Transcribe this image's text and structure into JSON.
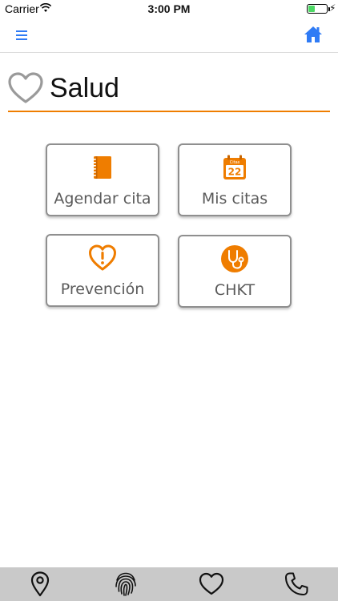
{
  "status_bar": {
    "carrier": "Carrier",
    "time": "3:00 PM",
    "battery_level": 0.35,
    "battery_color": "#4cd964",
    "icons": [
      "wifi-icon",
      "battery-icon",
      "charging-icon"
    ]
  },
  "nav_bar": {
    "left_icon": "menu-icon",
    "right_icon": "home-icon",
    "accent_color": "#2f7bf5"
  },
  "header": {
    "title": "Salud",
    "icon": "heart-outline-icon",
    "underline_color": "#ef7d00"
  },
  "tiles": [
    {
      "label": "Agendar cita",
      "icon": "notebook-icon"
    },
    {
      "label": "Mis citas",
      "icon": "calendar-icon",
      "calendar_header": "Citas",
      "calendar_day": "22"
    },
    {
      "label": "Prevención",
      "icon": "heart-alert-icon"
    },
    {
      "label": "CHKT",
      "icon": "stethoscope-icon"
    }
  ],
  "tab_bar": {
    "items": [
      {
        "icon": "location-pin-icon"
      },
      {
        "icon": "fingerprint-icon"
      },
      {
        "icon": "heart-icon"
      },
      {
        "icon": "phone-icon"
      }
    ]
  },
  "colors": {
    "accent_orange": "#ef7d00",
    "tile_border": "#8f8f8f",
    "tab_bar_bg": "#c9c9c9"
  }
}
